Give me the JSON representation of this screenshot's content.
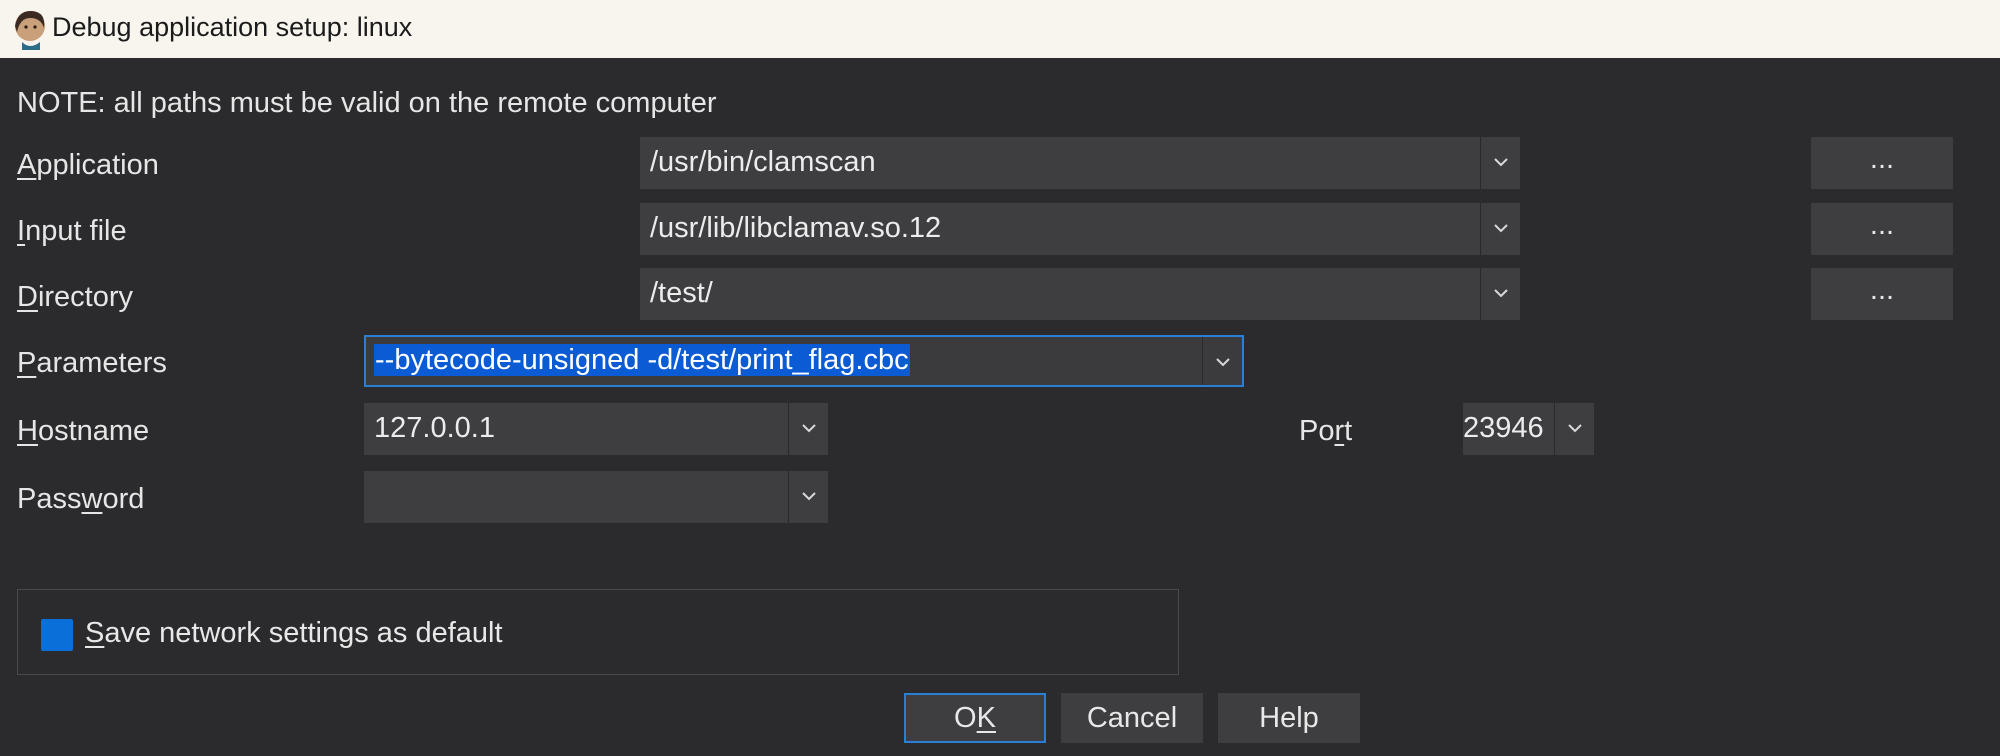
{
  "window": {
    "title": "Debug application setup: linux"
  },
  "note": "NOTE: all paths must be valid on the remote computer",
  "fields": {
    "application": {
      "label_mnemonic": "A",
      "label_rest": "pplication",
      "value": "/usr/bin/clamscan"
    },
    "input_file": {
      "label_mnemonic": "I",
      "label_rest": "nput file",
      "value": "/usr/lib/libclamav.so.12"
    },
    "directory": {
      "label_mnemonic": "D",
      "label_rest": "irectory",
      "value": "/test/"
    },
    "parameters": {
      "label_mnemonic": "P",
      "label_rest": "arameters",
      "value": "--bytecode-unsigned -d/test/print_flag.cbc"
    },
    "hostname": {
      "label_mnemonic": "H",
      "label_rest": "ostname",
      "value": "127.0.0.1"
    },
    "port": {
      "label_pre": "Po",
      "label_mnemonic": "r",
      "label_post": "t",
      "value": "23946"
    },
    "password": {
      "label_pre": "Pass",
      "label_mnemonic": "w",
      "label_post": "ord",
      "value": ""
    }
  },
  "browse_label": "...",
  "save_default": {
    "label_mnemonic": "S",
    "label_rest": "ave network settings as default",
    "checked": true
  },
  "buttons": {
    "ok": {
      "pre": "O",
      "mnemonic": "K"
    },
    "cancel": "Cancel",
    "help": "Help"
  },
  "colors": {
    "background": "#2b2b2d",
    "field": "#3e3e40",
    "accent": "#2a7fd4",
    "selection": "#0a5bd4",
    "titlebar": "#f7f5ee"
  }
}
